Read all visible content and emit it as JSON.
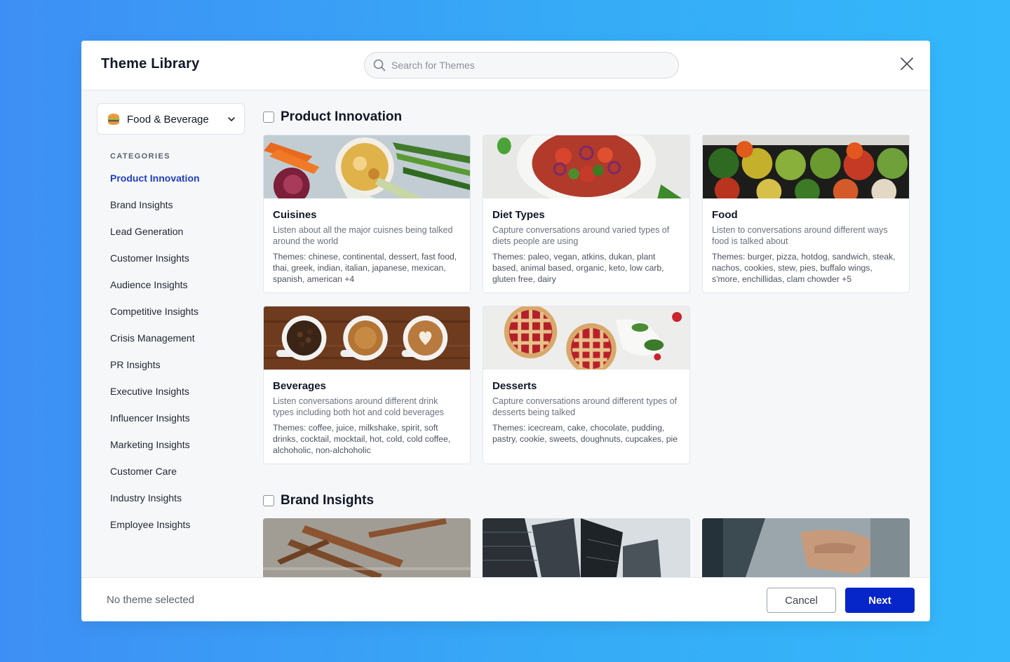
{
  "modal": {
    "title": "Theme Library"
  },
  "search": {
    "placeholder": "Search for Themes",
    "icon": "search-icon"
  },
  "sidebar": {
    "selected_industry": "Food & Beverage",
    "industry_icon": "burger-icon",
    "categories_title": "CATEGORIES",
    "categories": [
      {
        "label": "Product Innovation",
        "active": true
      },
      {
        "label": "Brand Insights",
        "active": false
      },
      {
        "label": "Lead Generation",
        "active": false
      },
      {
        "label": "Customer Insights",
        "active": false
      },
      {
        "label": "Audience Insights",
        "active": false
      },
      {
        "label": "Competitive Insights",
        "active": false
      },
      {
        "label": "Crisis Management",
        "active": false
      },
      {
        "label": "PR Insights",
        "active": false
      },
      {
        "label": "Executive Insights",
        "active": false
      },
      {
        "label": "Influencer Insights",
        "active": false
      },
      {
        "label": "Marketing Insights",
        "active": false
      },
      {
        "label": "Customer Care",
        "active": false
      },
      {
        "label": "Industry Insights",
        "active": false
      },
      {
        "label": "Employee Insights",
        "active": false
      }
    ]
  },
  "sections": [
    {
      "title": "Product Innovation",
      "cards": [
        {
          "title": "Cuisines",
          "description": "Listen about all the major cuisnes being talked around the world",
          "themes": "Themes: chinese, continental, dessert, fast food, thai, greek, indian, italian, japanese, mexican, spanish, american +4",
          "image": "cuisines-photo"
        },
        {
          "title": "Diet Types",
          "description": "Capture conversations around varied types of diets people are using",
          "themes": "Themes: paleo, vegan, atkins, dukan, plant based, animal based, organic, keto, low carb, gluten free, dairy",
          "image": "salad-photo"
        },
        {
          "title": "Food",
          "description": "Listen to conversations around different ways food is talked about",
          "themes": "Themes: burger, pizza, hotdog, sandwich, steak, nachos, cookies, stew, pies, buffalo wings, s'more, enchillidas, clam chowder +5",
          "image": "food-bowls-photo"
        },
        {
          "title": "Beverages",
          "description": "Listen conversations around different drink types including both hot and cold beverages",
          "themes": "Themes: coffee, juice, milkshake, spirit, soft drinks, cocktail, mocktail, hot, cold, cold coffee, alchoholic, non-alchoholic",
          "image": "coffee-photo"
        },
        {
          "title": "Desserts",
          "description": "Capture conversations around different types of desserts being talked",
          "themes": "Themes: icecream, cake, chocolate, pudding, pastry, cookie, sweets, doughnuts, cupcakes, pie",
          "image": "pies-photo"
        }
      ]
    },
    {
      "title": "Brand Insights",
      "images": [
        "wooden-cutlery-photo",
        "skyscrapers-photo",
        "laptop-typing-photo"
      ]
    }
  ],
  "footer": {
    "status": "No theme selected",
    "cancel_label": "Cancel",
    "next_label": "Next"
  },
  "colors": {
    "accent": "#1f3fbf",
    "primary_button": "#0626c9",
    "background_gradient_start": "#3e8ff5",
    "background_gradient_end": "#34b8fb"
  }
}
